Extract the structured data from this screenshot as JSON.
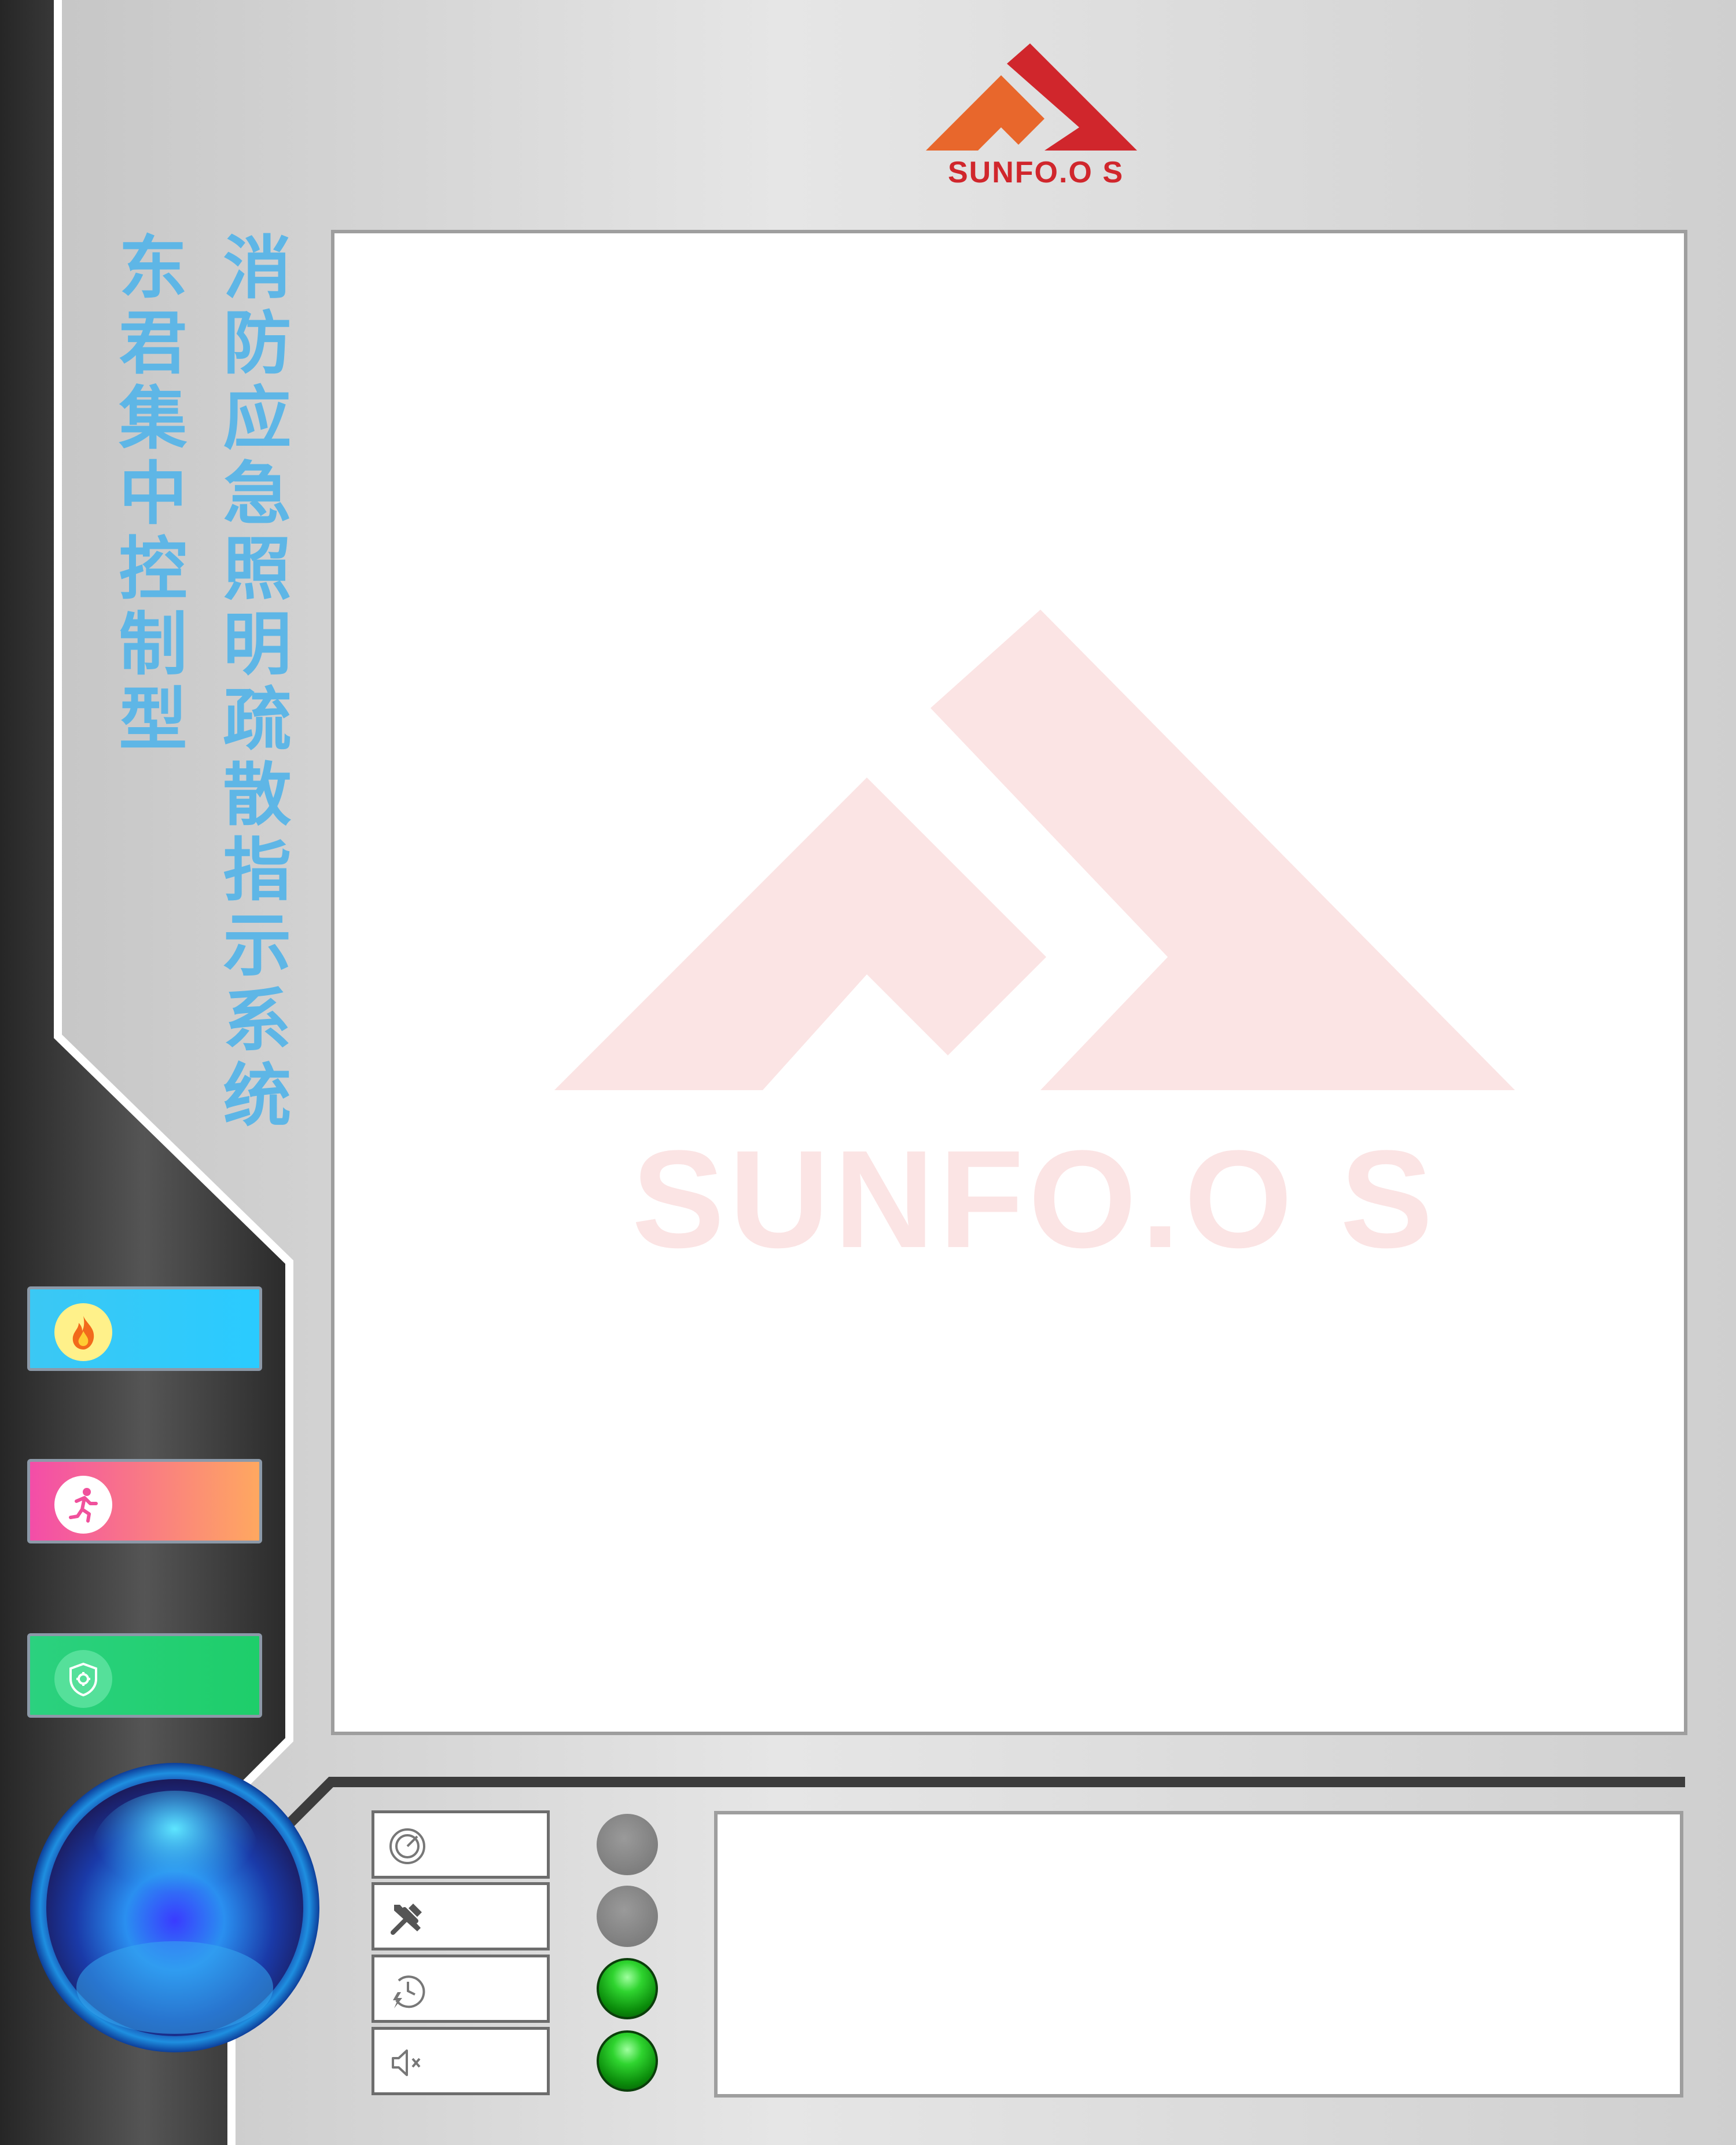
{
  "app": {
    "logo_text": "SUNFO.O S",
    "watermark_text": "SUNFO.O S",
    "title_main": "消防应急照明疏散指示系统",
    "title_sub": "东君集中控制型"
  },
  "colors": {
    "title": "#5eb6e6",
    "logo_orange": "#e8672c",
    "logo_red": "#d0262c",
    "rail_dark": "#3c3c3c",
    "led_off": "#8a8a8a",
    "led_on": "#1ea81e"
  },
  "nav": [
    {
      "id": "fire",
      "icon": "fire-icon"
    },
    {
      "id": "evacuation",
      "icon": "running-person-icon"
    },
    {
      "id": "safety",
      "icon": "shield-gear-icon"
    }
  ],
  "status": [
    {
      "id": "run",
      "icon": "gauge-icon",
      "led": "off"
    },
    {
      "id": "fault",
      "icon": "tools-icon",
      "led": "off"
    },
    {
      "id": "backup-power",
      "icon": "clock-lightning-icon",
      "led": "on"
    },
    {
      "id": "mute",
      "icon": "speaker-mute-icon",
      "led": "on"
    }
  ]
}
